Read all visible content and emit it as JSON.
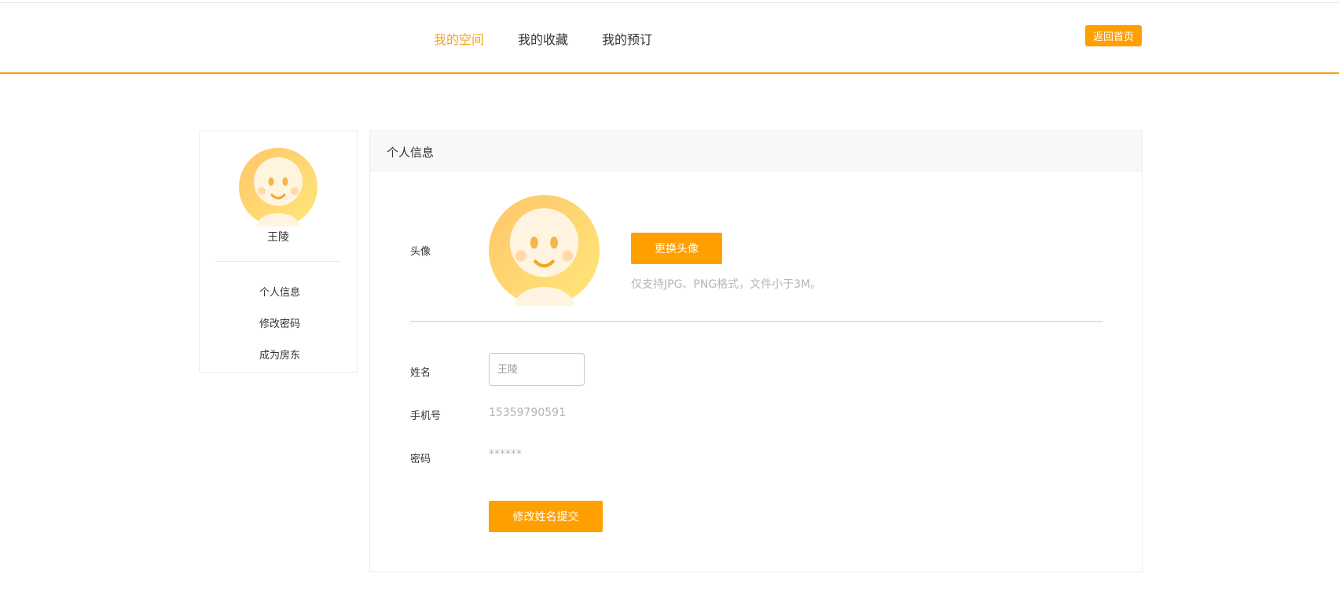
{
  "header": {
    "nav": [
      {
        "label": "我的空间",
        "active": true
      },
      {
        "label": "我的收藏",
        "active": false
      },
      {
        "label": "我的预订",
        "active": false
      }
    ],
    "home_button": "返回首页"
  },
  "sidebar": {
    "user_name": "王陵",
    "menu": [
      "个人信息",
      "修改密码",
      "成为房东"
    ]
  },
  "panel": {
    "title": "个人信息",
    "avatar_label": "头像",
    "change_avatar_button": "更换头像",
    "avatar_hint": "仅支持JPG、PNG格式，文件小于3M。",
    "name_label": "姓名",
    "name_placeholder": "王陵",
    "phone_label": "手机号",
    "phone_value": "15359790591",
    "password_label": "密码",
    "password_value": "******",
    "submit_button": "修改姓名提交"
  },
  "colors": {
    "accent": "#ff9f00",
    "nav_active": "#f7a21b",
    "muted_text": "#b5b5b5"
  },
  "icons": [
    "smiley-avatar-icon"
  ]
}
